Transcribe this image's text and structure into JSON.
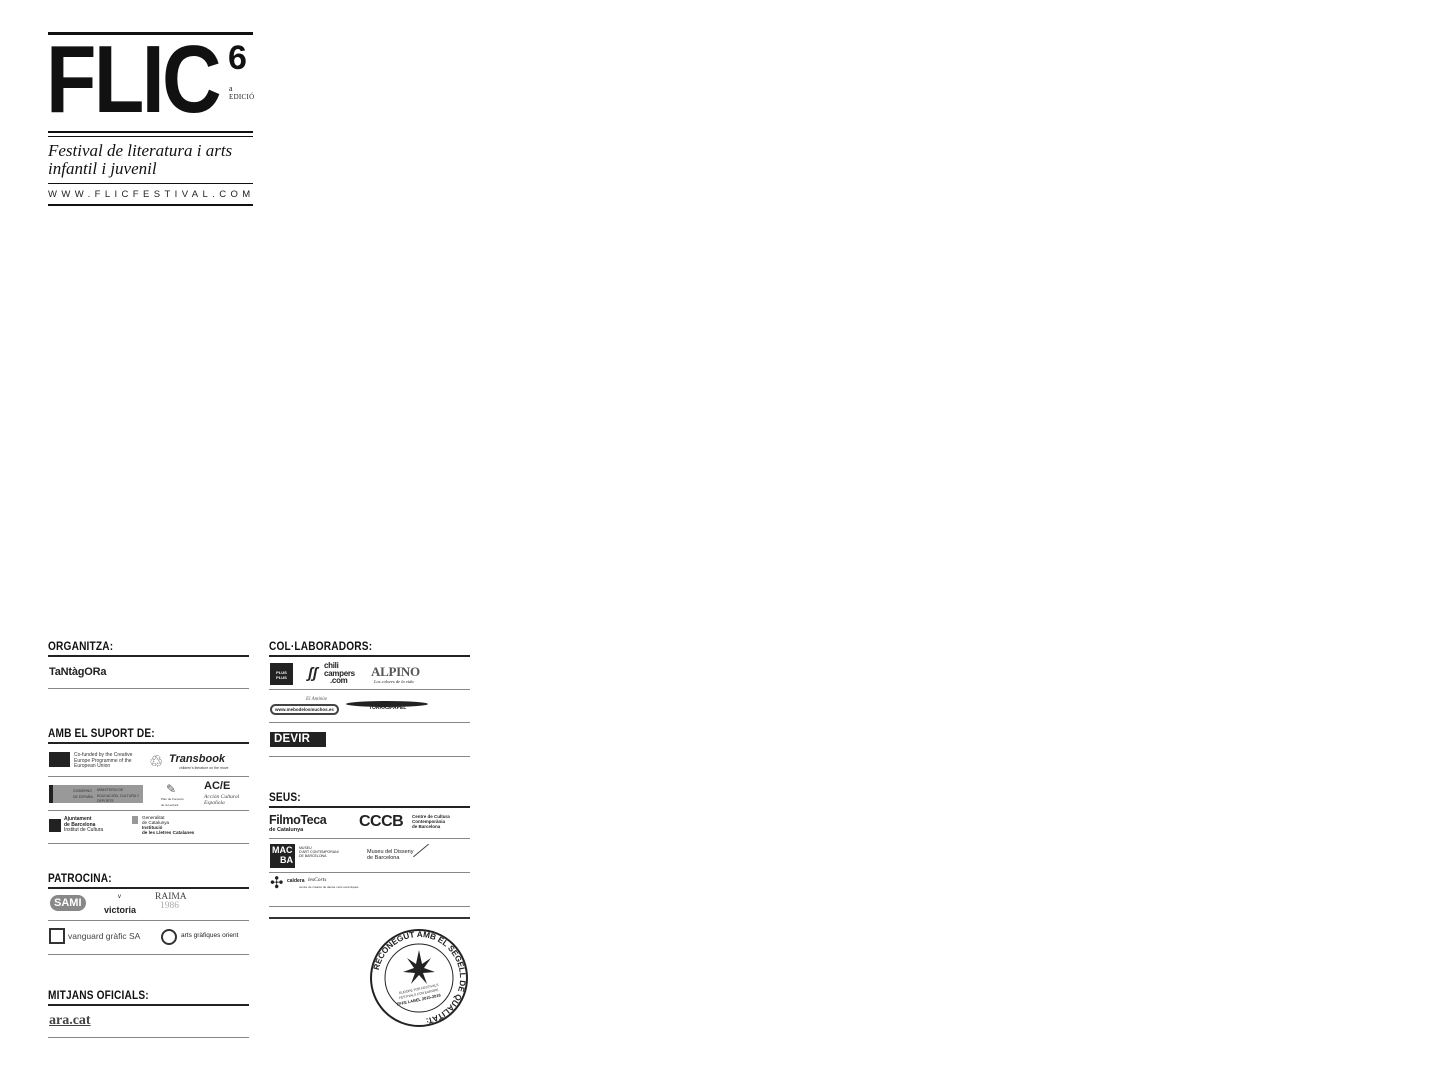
{
  "masthead": {
    "title": "FLIC",
    "edition_number": "6",
    "edition_sup": "a",
    "edition_label": "EDICIÓ",
    "tagline_line1": "Festival de literatura i arts",
    "tagline_line2": "infantil i juvenil",
    "url": "WWW.FLICFESTIVAL.COM"
  },
  "sections": {
    "organitza": {
      "title": "ORGANITZA:",
      "logos": [
        "TaNtàgORa"
      ]
    },
    "suport": {
      "title": "AMB EL SUPORT DE:",
      "logos": {
        "eu": "Co-funded by the Creative Europe Programme of the European Union",
        "transbook": "Transbook",
        "transbook_sub": "children's literature on the move",
        "gobierno": "GOBIERNO DE ESPAÑA",
        "ministerio": "MINISTERIO DE EDUCACIÓN, CULTURA Y DEPORTE",
        "plan": "Plan de Fomento de la Lectura",
        "ace": "AC/E",
        "ace_sub1": "Acción Cultural",
        "ace_sub2": "Española",
        "ajuntament1": "Ajuntament",
        "ajuntament2": "de Barcelona",
        "ajuntament3": "Institut de Cultura",
        "generalitat1": "Generalitat",
        "generalitat2": "de Catalunya",
        "generalitat3": "Institució",
        "generalitat4": "de les Lletres Catalanes"
      }
    },
    "patrocina": {
      "title": "PATROCINA:",
      "logos": {
        "sami": "SAMI",
        "victoria": "victoria",
        "raima1": "RAIMA",
        "raima2": "1986",
        "vanguard": "vanguard gràfic SA",
        "orient": "arts gràfiques orient"
      }
    },
    "mitjans": {
      "title": "MITJANS OFICIALS:",
      "logos": [
        "ara.cat"
      ]
    },
    "collaboradors": {
      "title": "COL·LABORADORS:",
      "logos": {
        "plus": "PLUS PLUS",
        "chili1": "chili",
        "chili2": "campers",
        "chili3": ".com",
        "alpino": "ALPINO",
        "alpino_sub": "Los colores de la vida",
        "antinoe1": "El Antinòe",
        "antinoe2": "www.mebodelosmuchos.es",
        "torras": "TORRASPAPEL",
        "devir": "DEVIR"
      }
    },
    "seus": {
      "title": "SEUS:",
      "logos": {
        "filmoteca1": "FilmoTeca",
        "filmoteca2": "de Catalunya",
        "cccb": "CCCB",
        "cccb_sub1": "Centre de Cultura",
        "cccb_sub2": "Contemporània",
        "cccb_sub3": "de Barcelona",
        "macba1": "MAC",
        "macba2": "BA",
        "macba_sub1": "MUSEU",
        "macba_sub2": "D'ART CONTEMPORANI",
        "macba_sub3": "DE BARCELONA",
        "disseny1": "Museu del Disseny",
        "disseny2": "de Barcelona",
        "caldera1": "caldera",
        "caldera2": "lesCorts",
        "caldera_sub": "centre de creació de dansa i arts escèniques"
      }
    }
  },
  "seal": {
    "outer_text": "RECONEGUT AMB EL SEGELL DE QUALITAT:",
    "inner1": "EUROPE FOR FESTIVALS",
    "inner2": "FESTIVALS FOR EUROPE",
    "inner3": "EFFE LABEL 2015-2016"
  }
}
